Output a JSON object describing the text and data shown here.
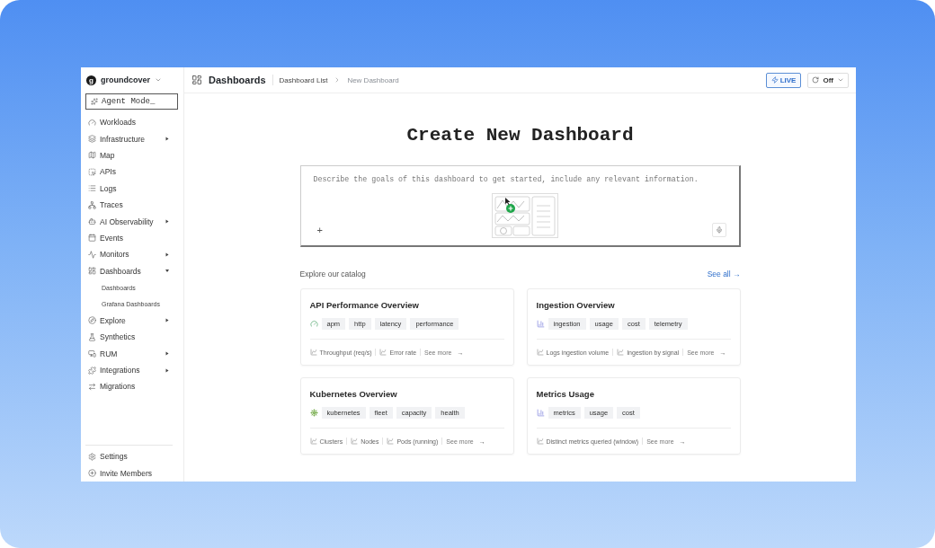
{
  "brand": {
    "name": "groundcover",
    "initial": "g"
  },
  "agent_mode": {
    "label": "Agent Mode_"
  },
  "sidebar": {
    "items": [
      {
        "label": "Workloads",
        "kind": "link"
      },
      {
        "label": "Infrastructure",
        "kind": "group",
        "expanded": false
      },
      {
        "label": "Map",
        "kind": "link"
      },
      {
        "label": "APIs",
        "kind": "link"
      },
      {
        "label": "Logs",
        "kind": "link"
      },
      {
        "label": "Traces",
        "kind": "link"
      },
      {
        "label": "AI Observability",
        "kind": "group",
        "expanded": false
      },
      {
        "label": "Events",
        "kind": "link"
      },
      {
        "label": "Monitors",
        "kind": "group",
        "expanded": false
      },
      {
        "label": "Dashboards",
        "kind": "group",
        "expanded": true,
        "children": [
          {
            "label": "Dashboards"
          },
          {
            "label": "Grafana Dashboards"
          }
        ]
      },
      {
        "label": "Explore",
        "kind": "group",
        "expanded": false
      },
      {
        "label": "Synthetics",
        "kind": "link"
      },
      {
        "label": "RUM",
        "kind": "group",
        "expanded": false
      },
      {
        "label": "Integrations",
        "kind": "group",
        "expanded": false
      },
      {
        "label": "Migrations",
        "kind": "link"
      }
    ],
    "footer": [
      {
        "label": "Settings"
      },
      {
        "label": "Invite Members"
      }
    ]
  },
  "header": {
    "title": "Dashboards",
    "breadcrumb": [
      "Dashboard List",
      "New Dashboard"
    ],
    "live": {
      "label": "LIVE"
    },
    "refresh": {
      "value": "Off"
    }
  },
  "main": {
    "heading": "Create New Dashboard",
    "prompt": {
      "placeholder": "Describe the goals of this dashboard to get started, include any relevant information.",
      "add": "+"
    },
    "catalog": {
      "label": "Explore our catalog",
      "see_all": "See all →",
      "cards": [
        {
          "title": "API Performance Overview",
          "tags": [
            "apm",
            "http",
            "latency",
            "performance"
          ],
          "metrics": [
            "Throughput (req/s)",
            "Error rate"
          ],
          "more": "See more",
          "arrow": "→"
        },
        {
          "title": "Ingestion Overview",
          "tags": [
            "ingestion",
            "usage",
            "cost",
            "telemetry"
          ],
          "metrics": [
            "Logs ingestion volume",
            "Ingestion by signal"
          ],
          "more": "See more",
          "arrow": "→"
        },
        {
          "title": "Kubernetes Overview",
          "tags": [
            "kubernetes",
            "fleet",
            "capacity",
            "health"
          ],
          "metrics": [
            "Clusters",
            "Nodes",
            "Pods (running)"
          ],
          "more": "See more",
          "arrow": "→"
        },
        {
          "title": "Metrics Usage",
          "tags": [
            "metrics",
            "usage",
            "cost"
          ],
          "metrics": [
            "Distinct metrics queried (window)"
          ],
          "more": "See more",
          "arrow": "→"
        }
      ]
    }
  }
}
